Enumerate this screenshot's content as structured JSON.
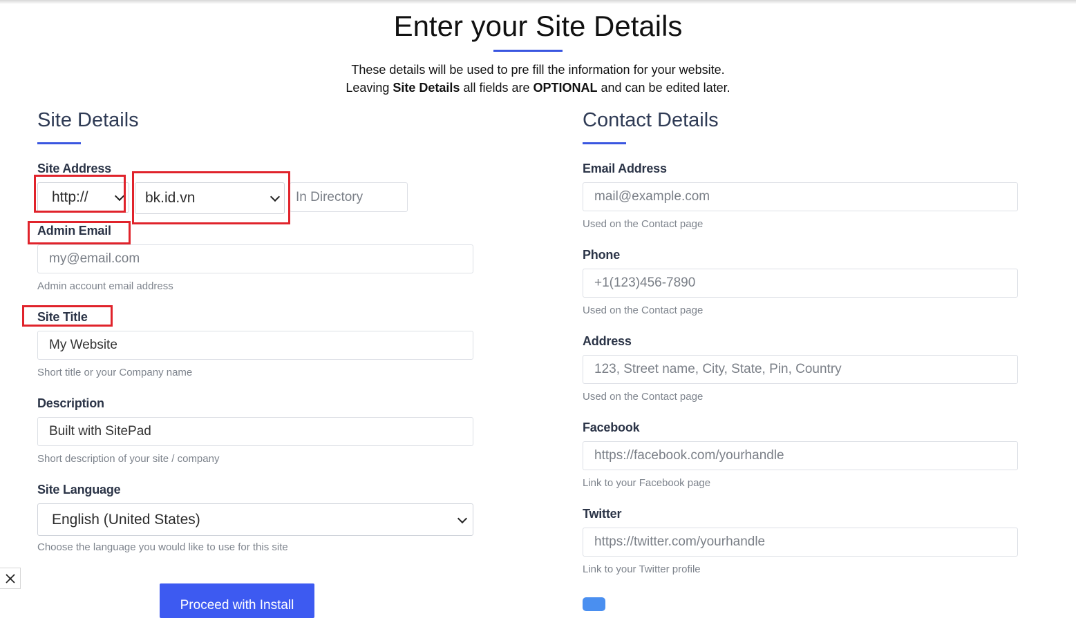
{
  "header": {
    "title": "Enter your Site Details",
    "intro_line1": "These details will be used to pre fill the information for your website.",
    "intro_line2_a": "Leaving ",
    "intro_line2_b": "Site Details",
    "intro_line2_c": " all fields are ",
    "intro_line2_d": "OPTIONAL",
    "intro_line2_e": " and can be edited later."
  },
  "site_details": {
    "heading": "Site Details",
    "site_address": {
      "label": "Site Address",
      "protocol": "http://",
      "domain": "bk.id.vn",
      "directory_placeholder": "In Directory"
    },
    "admin_email": {
      "label": "Admin Email",
      "placeholder": "my@email.com",
      "help": "Admin account email address"
    },
    "site_title": {
      "label": "Site Title",
      "value": "My Website",
      "help": "Short title or your Company name"
    },
    "description": {
      "label": "Description",
      "value": "Built with SitePad",
      "help": "Short description of your site / company"
    },
    "site_language": {
      "label": "Site Language",
      "value": "English (United States)",
      "help": "Choose the language you would like to use for this site"
    }
  },
  "contact_details": {
    "heading": "Contact Details",
    "email": {
      "label": "Email Address",
      "placeholder": "mail@example.com",
      "help": "Used on the Contact page"
    },
    "phone": {
      "label": "Phone",
      "placeholder": "+1(123)456-7890",
      "help": "Used on the Contact page"
    },
    "address": {
      "label": "Address",
      "placeholder": "123, Street name, City, State, Pin, Country",
      "help": "Used on the Contact page"
    },
    "facebook": {
      "label": "Facebook",
      "placeholder": "https://facebook.com/yourhandle",
      "help": "Link to your Facebook page"
    },
    "twitter": {
      "label": "Twitter",
      "placeholder": "https://twitter.com/yourhandle",
      "help": "Link to your Twitter profile"
    }
  },
  "actions": {
    "proceed_label": "Proceed with Install"
  },
  "colors": {
    "accent": "#3d5af1",
    "highlight": "#e0232b"
  },
  "icons": {
    "close": "close-icon",
    "dropdown": "chevron-down-icon"
  }
}
